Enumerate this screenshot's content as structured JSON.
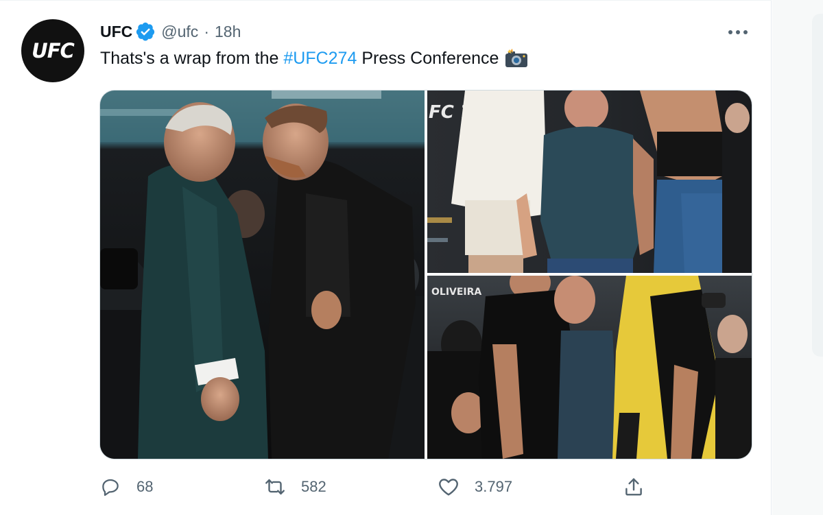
{
  "tweet": {
    "display_name": "UFC",
    "handle": "@ufc",
    "separator": "·",
    "time": "18h",
    "text_before": "Thats's a wrap from the ",
    "hashtag": "#UFC274",
    "text_after": " Press Conference",
    "emoji": "camera-flash-icon",
    "avatar_logo": "UFC",
    "verified": true
  },
  "media": {
    "photos": [
      {
        "name": "faceoff-photo",
        "overlay_text": ""
      },
      {
        "name": "faceoff-standing-photo",
        "overlay_text": "FC 74"
      },
      {
        "name": "crowd-faceoff-photo",
        "overlay_text": "OLIVEIRA"
      }
    ]
  },
  "actions": {
    "reply_count": "68",
    "retweet_count": "582",
    "like_count": "3.797"
  },
  "colors": {
    "accent": "#1d9bf0",
    "text_primary": "#0f1419",
    "text_secondary": "#536471",
    "verified": "#1d9bf0"
  }
}
